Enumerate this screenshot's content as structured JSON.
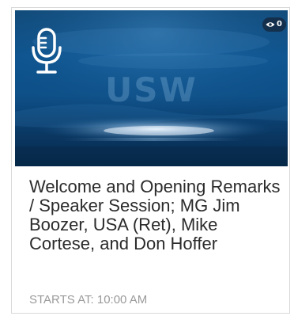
{
  "session_card": {
    "icon": "microphone-icon",
    "brand_watermark": "USW",
    "view_count": "0",
    "view_icon": "eye-icon",
    "title": "Welcome and Opening Remarks / Speaker Session; MG Jim Boozer, USA (Ret), Mike Cortese, and Don Hoffer",
    "start_label": "STARTS AT:",
    "start_time": "10:00 AM",
    "colors": {
      "hero_dark": "#062a4c",
      "hero_mid": "#0f5590",
      "title_text": "#2b2b2b",
      "meta_text": "#9a9a9a"
    }
  }
}
